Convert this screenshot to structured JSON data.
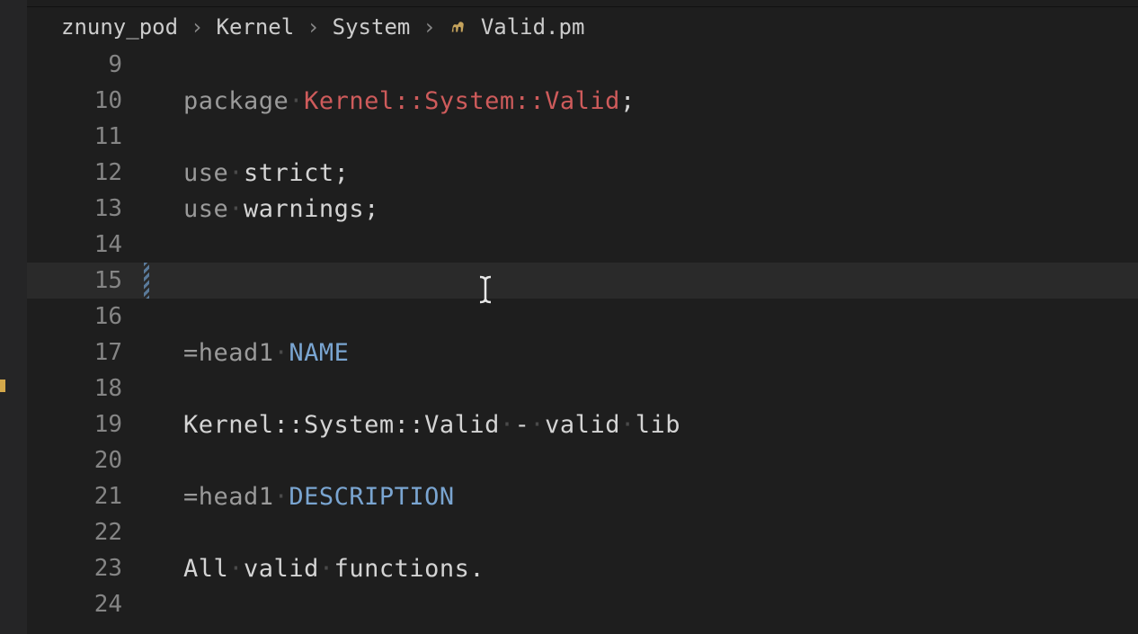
{
  "breadcrumb": {
    "items": [
      "znuny_pod",
      "Kernel",
      "System",
      "Valid.pm"
    ],
    "fileIcon": "camel-icon"
  },
  "editor": {
    "currentLine": 15,
    "cursorColumn": 13,
    "lines": [
      {
        "num": 9,
        "tokens": []
      },
      {
        "num": 10,
        "tokens": [
          {
            "t": "package",
            "c": "keyword2"
          },
          {
            "t": "·",
            "c": "dot"
          },
          {
            "t": "Kernel::System::Valid",
            "c": "class"
          },
          {
            "t": ";",
            "c": "punct"
          }
        ]
      },
      {
        "num": 11,
        "tokens": []
      },
      {
        "num": 12,
        "tokens": [
          {
            "t": "use",
            "c": "keyword2"
          },
          {
            "t": "·",
            "c": "dot"
          },
          {
            "t": "strict",
            "c": "ident"
          },
          {
            "t": ";",
            "c": "punct"
          }
        ]
      },
      {
        "num": 13,
        "tokens": [
          {
            "t": "use",
            "c": "keyword2"
          },
          {
            "t": "·",
            "c": "dot"
          },
          {
            "t": "warnings",
            "c": "ident"
          },
          {
            "t": ";",
            "c": "punct"
          }
        ]
      },
      {
        "num": 14,
        "tokens": []
      },
      {
        "num": 15,
        "tokens": [],
        "modified": true,
        "current": true
      },
      {
        "num": 16,
        "tokens": []
      },
      {
        "num": 17,
        "tokens": [
          {
            "t": "=head1",
            "c": "pod"
          },
          {
            "t": "·",
            "c": "dot"
          },
          {
            "t": "NAME",
            "c": "podlabel"
          }
        ]
      },
      {
        "num": 18,
        "tokens": []
      },
      {
        "num": 19,
        "tokens": [
          {
            "t": "Kernel::System::Valid",
            "c": "ident"
          },
          {
            "t": "·",
            "c": "dot"
          },
          {
            "t": "-",
            "c": "ident"
          },
          {
            "t": "·",
            "c": "dot"
          },
          {
            "t": "valid",
            "c": "ident"
          },
          {
            "t": "·",
            "c": "dot"
          },
          {
            "t": "lib",
            "c": "ident"
          }
        ]
      },
      {
        "num": 20,
        "tokens": []
      },
      {
        "num": 21,
        "tokens": [
          {
            "t": "=head1",
            "c": "pod"
          },
          {
            "t": "·",
            "c": "dot"
          },
          {
            "t": "DESCRIPTION",
            "c": "podlabel"
          }
        ]
      },
      {
        "num": 22,
        "tokens": []
      },
      {
        "num": 23,
        "tokens": [
          {
            "t": "All",
            "c": "ident"
          },
          {
            "t": "·",
            "c": "dot"
          },
          {
            "t": "valid",
            "c": "ident"
          },
          {
            "t": "·",
            "c": "dot"
          },
          {
            "t": "functions.",
            "c": "ident"
          }
        ]
      },
      {
        "num": 24,
        "tokens": []
      }
    ]
  }
}
